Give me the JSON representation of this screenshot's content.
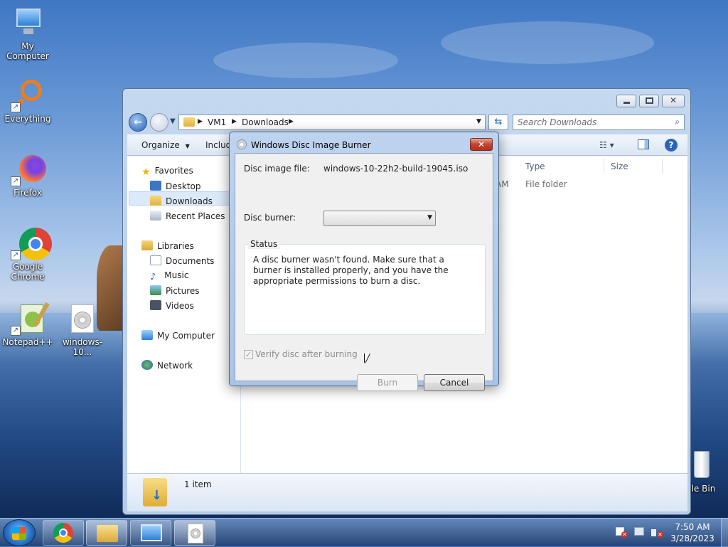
{
  "desktop": {
    "icons": [
      {
        "label": "My Computer"
      },
      {
        "label": "Everything"
      },
      {
        "label": "Firefox"
      },
      {
        "label": "Google Chrome"
      },
      {
        "label": "Notepad++"
      },
      {
        "label": "windows-10..."
      },
      {
        "label": "cle Bin"
      }
    ]
  },
  "explorer": {
    "breadcrumb": [
      "VM1",
      "Downloads"
    ],
    "search_placeholder": "Search Downloads",
    "toolbar": {
      "organize": "Organize",
      "include": "Includ"
    },
    "columns": {
      "type": "Type",
      "size": "Size"
    },
    "row": {
      "modified_tail": "AM",
      "type": "File folder"
    },
    "nav": {
      "favorites": "Favorites",
      "desktop": "Desktop",
      "downloads": "Downloads",
      "recent": "Recent Places",
      "libraries": "Libraries",
      "documents": "Documents",
      "music": "Music",
      "pictures": "Pictures",
      "videos": "Videos",
      "computer": "My Computer",
      "network": "Network"
    },
    "status": "1 item"
  },
  "dialog": {
    "title": "Windows Disc Image Burner",
    "file_label": "Disc image file:",
    "file_value": "windows-10-22h2-build-19045.iso",
    "burner_label": "Disc burner:",
    "burner_value": "",
    "status_label": "Status",
    "status_text": "A disc burner wasn't found. Make sure that a burner is installed properly, and you have the appropriate permissions to burn a disc.",
    "verify_label": "Verify disc after burning",
    "verify_checked": true,
    "burn_label": "Burn",
    "cancel_label": "Cancel",
    "close_glyph": "✕"
  },
  "taskbar": {
    "time": "7:50 AM",
    "date": "3/28/2023"
  },
  "colors": {
    "accent": "#2a66b8",
    "close": "#c2442f"
  }
}
